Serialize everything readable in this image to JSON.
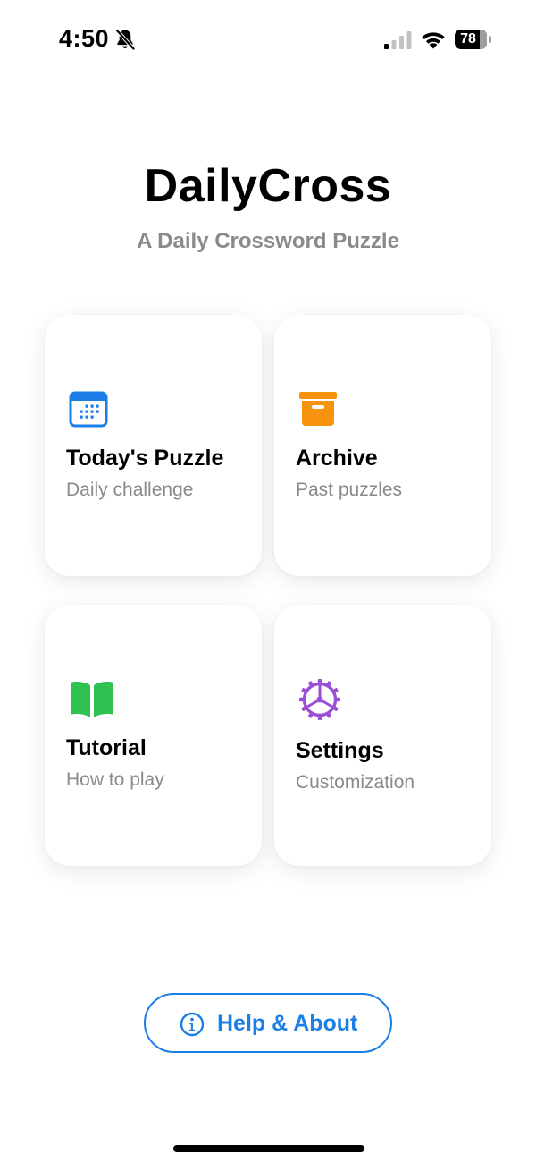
{
  "status_bar": {
    "time": "4:50",
    "battery_level": "78",
    "icons": [
      "bell-slash-icon",
      "cellular-signal-icon",
      "wifi-icon",
      "battery-icon"
    ]
  },
  "header": {
    "title": "DailyCross",
    "subtitle": "A Daily Crossword Puzzle"
  },
  "menu": {
    "cards": [
      {
        "title": "Today's Puzzle",
        "subtitle": "Daily challenge",
        "icon": "calendar-icon",
        "color": "#1a7ee6"
      },
      {
        "title": "Archive",
        "subtitle": "Past puzzles",
        "icon": "archive-box-icon",
        "color": "#f7930f"
      },
      {
        "title": "Tutorial",
        "subtitle": "How to play",
        "icon": "book-icon",
        "color": "#2fc253"
      },
      {
        "title": "Settings",
        "subtitle": "Customization",
        "icon": "gear-icon",
        "color": "#9b4fd6"
      }
    ]
  },
  "footer": {
    "help_label": "Help & About",
    "help_icon": "info-circle-icon",
    "accent_color": "#1c7fe6"
  }
}
